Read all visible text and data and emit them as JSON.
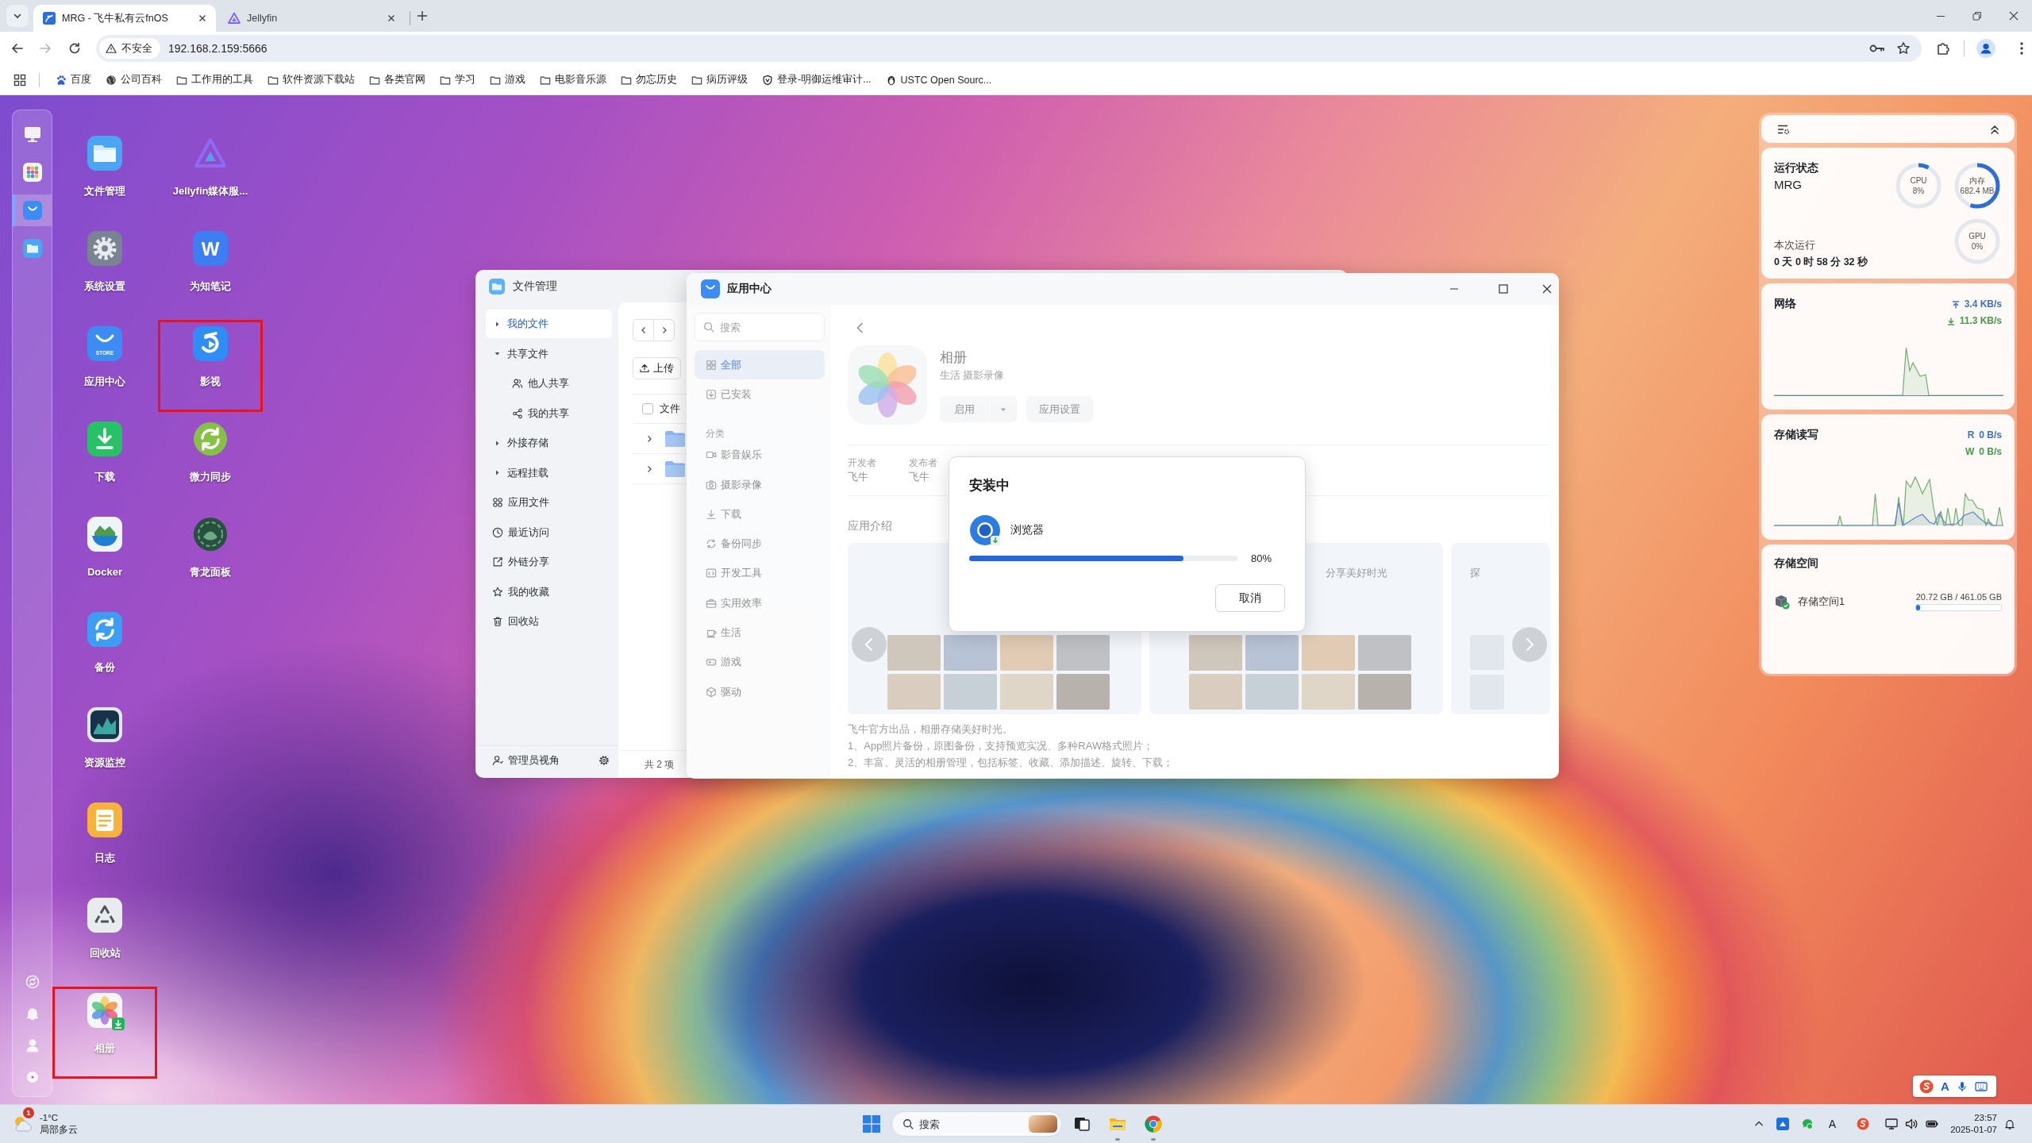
{
  "browser": {
    "tabs": [
      {
        "title": "MRG - 飞牛私有云fnOS",
        "kind": "fnos",
        "selected": true
      },
      {
        "title": "Jellyfin",
        "kind": "jellyfin",
        "selected": false
      }
    ],
    "security_label": "不安全",
    "url": "192.168.2.159:5666",
    "bookmarks": [
      {
        "label": "百度",
        "kind": "baidu"
      },
      {
        "label": "公司百科",
        "kind": "globe"
      },
      {
        "label": "工作用的工具",
        "kind": "folder"
      },
      {
        "label": "软件资源下载站",
        "kind": "folder"
      },
      {
        "label": "各类官网",
        "kind": "folder"
      },
      {
        "label": "学习",
        "kind": "folder"
      },
      {
        "label": "游戏",
        "kind": "folder"
      },
      {
        "label": "电影音乐源",
        "kind": "folder"
      },
      {
        "label": "勿忘历史",
        "kind": "folder"
      },
      {
        "label": "病历评级",
        "kind": "folder"
      },
      {
        "label": "登录-明御运维审计...",
        "kind": "shield"
      },
      {
        "label": "USTC Open Sourc...",
        "kind": "penguin"
      }
    ]
  },
  "dock": {
    "items": [
      {
        "kind": "monitor",
        "selected": false
      },
      {
        "kind": "apps",
        "selected": false
      },
      {
        "kind": "store",
        "selected": true
      },
      {
        "kind": "files",
        "selected": false
      }
    ],
    "utilities": [
      {
        "kind": "refresh"
      },
      {
        "kind": "bell"
      },
      {
        "kind": "user"
      },
      {
        "kind": "gear"
      }
    ]
  },
  "desktop_icons": [
    {
      "label": "文件管理",
      "kind": "files",
      "highlighted": false,
      "installing": false
    },
    {
      "label": "系统设置",
      "kind": "settings",
      "highlighted": false,
      "installing": false
    },
    {
      "label": "应用中心",
      "kind": "store",
      "logo_text": "STORE",
      "highlighted": false,
      "installing": false
    },
    {
      "label": "下载",
      "kind": "download",
      "highlighted": false,
      "installing": false
    },
    {
      "label": "Docker",
      "kind": "docker",
      "highlighted": false,
      "installing": false
    },
    {
      "label": "备份",
      "kind": "backup",
      "highlighted": false,
      "installing": false
    },
    {
      "label": "资源监控",
      "kind": "monitor",
      "highlighted": false,
      "installing": false
    },
    {
      "label": "日志",
      "kind": "log",
      "highlighted": false,
      "installing": false
    },
    {
      "label": "回收站",
      "kind": "trash",
      "highlighted": false,
      "installing": false
    },
    {
      "label": "相册",
      "kind": "photos",
      "highlighted": true,
      "installing": true
    },
    {
      "label": "Jellyfin媒体服...",
      "kind": "jellyfin",
      "highlighted": false,
      "installing": false
    },
    {
      "label": "为知笔记",
      "kind": "notes",
      "logo_text": "W",
      "highlighted": false,
      "installing": false
    },
    {
      "label": "影视",
      "kind": "video",
      "highlighted": true,
      "installing": false
    },
    {
      "label": "微力同步",
      "kind": "sync",
      "highlighted": false,
      "installing": false
    },
    {
      "label": "青龙面板",
      "kind": "qinglong",
      "highlighted": false,
      "installing": false
    }
  ],
  "file_manager": {
    "title": "文件管理",
    "sidebar": {
      "groups": [
        {
          "label": "我的文件",
          "selected": true,
          "expanded": false
        },
        {
          "label": "共享文件",
          "selected": false,
          "expanded": true,
          "children": [
            {
              "label": "他人共享",
              "kind": "people",
              "selected": false
            },
            {
              "label": "我的共享",
              "kind": "share",
              "selected": false
            }
          ]
        },
        {
          "label": "外接存储",
          "selected": false,
          "expanded": false
        },
        {
          "label": "远程挂载",
          "selected": false,
          "expanded": false
        }
      ],
      "links": [
        {
          "label": "应用文件",
          "kind": "apps",
          "selected": false
        },
        {
          "label": "最近访问",
          "kind": "recent",
          "selected": false
        },
        {
          "label": "外链分享",
          "kind": "link",
          "selected": false
        },
        {
          "label": "我的收藏",
          "kind": "star",
          "selected": false
        },
        {
          "label": "回收站",
          "kind": "trash",
          "selected": false
        }
      ],
      "footer": "管理员视角"
    },
    "upload_button": "上传",
    "select_all": {
      "checked": false
    },
    "column_1": "文件",
    "rows": [
      {
        "kind": "folder",
        "expanded": false
      },
      {
        "kind": "folder",
        "expanded": false
      }
    ],
    "item_count": "共 2 项"
  },
  "app_center": {
    "title": "应用中心",
    "search": {
      "placeholder": "搜索"
    },
    "nav": [
      {
        "label": "全部",
        "kind": "grid",
        "selected": true
      },
      {
        "label": "已安装",
        "kind": "installed",
        "selected": false
      }
    ],
    "category_heading": "分类",
    "categories": [
      {
        "label": "影音娱乐",
        "kind": "video",
        "selected": false
      },
      {
        "label": "摄影录像",
        "kind": "camera",
        "selected": false
      },
      {
        "label": "下载",
        "kind": "download",
        "selected": false
      },
      {
        "label": "备份同步",
        "kind": "sync",
        "selected": false
      },
      {
        "label": "开发工具",
        "kind": "code",
        "selected": false
      },
      {
        "label": "实用效率",
        "kind": "briefcase",
        "selected": false
      },
      {
        "label": "生活",
        "kind": "cup",
        "selected": false
      },
      {
        "label": "游戏",
        "kind": "gamepad",
        "selected": false
      },
      {
        "label": "驱动",
        "kind": "cube",
        "selected": false
      }
    ],
    "app": {
      "name": "相册",
      "tags": "生活 摄影录像",
      "open_button": "启用",
      "settings_button": "应用设置",
      "meta": [
        {
          "label": "开发者",
          "value": "飞牛"
        },
        {
          "label": "发布者",
          "value": "飞牛"
        }
      ],
      "intro_heading": "应用介绍",
      "screenshots": [
        {
          "kind": "photo-grid"
        },
        {
          "kind": "photo-grid",
          "caption": "分享美好时光"
        },
        {
          "kind": "photo-list",
          "caption": "探"
        }
      ],
      "description": [
        "飞牛官方出品，相册存储美好时光。",
        "1、App照片备份，原图备份，支持预览实况、多种RAW格式照片；",
        "2、丰富、灵活的相册管理，包括标签、收藏、添加描述、旋转、下载；"
      ]
    },
    "install_dialog": {
      "title": "安装中",
      "app_name": "浏览器",
      "level": 0.8,
      "percent": "80%",
      "cancel_button": "取消"
    }
  },
  "widgets": {
    "status": {
      "title": "运行状态",
      "host": "MRG",
      "gauges": [
        {
          "label": "CPU",
          "value": "8%",
          "level": 0.08
        },
        {
          "label": "内存",
          "value": "682.4 MB",
          "level": 0.55
        },
        {
          "label": "GPU",
          "value": "0%"
        }
      ],
      "uptime_label": "本次运行",
      "uptime": "0 天 0 时 58 分 32 秒"
    },
    "network": {
      "title": "网络",
      "upload": "3.4 KB/s",
      "download": "11.3 KB/s"
    },
    "disk_io": {
      "title": "存储读写",
      "read_label": "R",
      "read": "0 B/s",
      "write_label": "W",
      "write": "0 B/s"
    },
    "storage": {
      "title": "存储空间",
      "volumes": [
        {
          "name": "存储空间1",
          "usage": "20.72 GB / 461.05 GB",
          "level": 0.045
        }
      ]
    }
  },
  "ime_toolbar": {
    "mode": "A"
  },
  "taskbar": {
    "weather": {
      "badge": "1",
      "temperature": "-1°C",
      "condition": "局部多云"
    },
    "search": {
      "placeholder": "搜索"
    },
    "apps": [
      {
        "kind": "task-view",
        "running": false
      },
      {
        "kind": "explorer",
        "running": true
      },
      {
        "kind": "chrome",
        "running": true
      }
    ],
    "tray": {
      "input_mode": "A"
    },
    "time": "23:57",
    "date": "2025-01-07"
  }
}
